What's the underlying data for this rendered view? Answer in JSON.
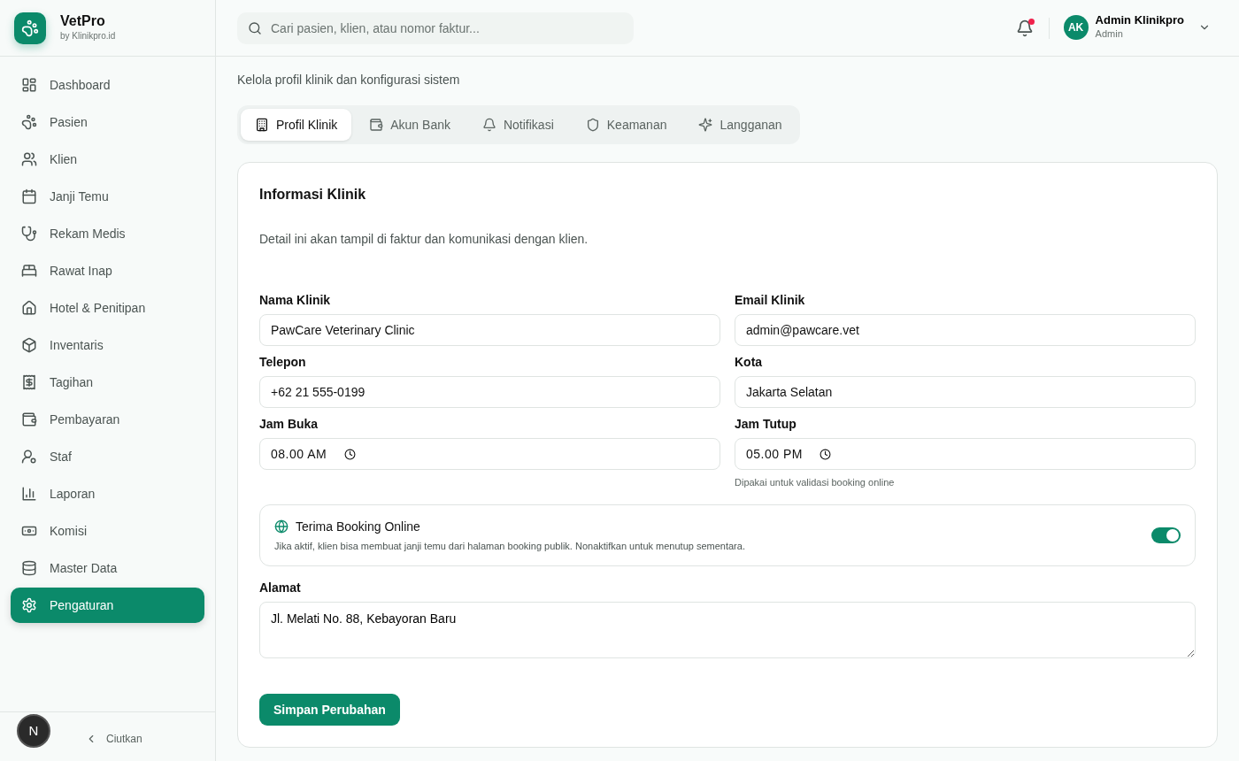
{
  "brand": {
    "name": "VetPro",
    "tagline": "by Klinikpro.id"
  },
  "sidebar": {
    "items": [
      {
        "label": "Dashboard",
        "selected": false
      },
      {
        "label": "Pasien",
        "selected": false
      },
      {
        "label": "Klien",
        "selected": false
      },
      {
        "label": "Janji Temu",
        "selected": false
      },
      {
        "label": "Rekam Medis",
        "selected": false
      },
      {
        "label": "Rawat Inap",
        "selected": false
      },
      {
        "label": "Hotel & Penitipan",
        "selected": false
      },
      {
        "label": "Inventaris",
        "selected": false
      },
      {
        "label": "Tagihan",
        "selected": false
      },
      {
        "label": "Pembayaran",
        "selected": false
      },
      {
        "label": "Staf",
        "selected": false
      },
      {
        "label": "Laporan",
        "selected": false
      },
      {
        "label": "Komisi",
        "selected": false
      },
      {
        "label": "Master Data",
        "selected": false
      },
      {
        "label": "Pengaturan",
        "selected": true
      }
    ],
    "collapse": "Ciutkan"
  },
  "dev_badge": "N",
  "search": {
    "placeholder": "Cari pasien, klien, atau nomor faktur..."
  },
  "notifications": {
    "unread": true
  },
  "user": {
    "initials": "AK",
    "name": "Admin Klinikpro",
    "role": "Admin"
  },
  "page": {
    "subtitle": "Kelola profil klinik dan konfigurasi sistem"
  },
  "tabs": [
    {
      "label": "Profil Klinik",
      "selected": true
    },
    {
      "label": "Akun Bank",
      "selected": false
    },
    {
      "label": "Notifikasi",
      "selected": false
    },
    {
      "label": "Keamanan",
      "selected": false
    },
    {
      "label": "Langganan",
      "selected": false
    }
  ],
  "card": {
    "title": "Informasi Klinik",
    "description": "Detail ini akan tampil di faktur dan komunikasi dengan klien.",
    "fields": [
      {
        "label": "Nama Klinik",
        "value": "PawCare Veterinary Clinic",
        "kind": "text"
      },
      {
        "label": "Email Klinik",
        "value": "admin@pawcare.vet",
        "kind": "text"
      },
      {
        "label": "Telepon",
        "value": "+62 21 555-0199",
        "kind": "text"
      },
      {
        "label": "Kota",
        "value": "Jakarta Selatan",
        "kind": "text"
      },
      {
        "label": "Jam Buka",
        "value": "08.00 AM",
        "kind": "time"
      },
      {
        "label": "Jam Tutup",
        "value": "05.00 PM",
        "kind": "time",
        "hint": "Dipakai untuk validasi booking online"
      }
    ],
    "booking": {
      "title": "Terima Booking Online",
      "description": "Jika aktif, klien bisa membuat janji temu dari halaman booking publik. Nonaktifkan untuk menutup sementara.",
      "on": true
    },
    "address": {
      "label": "Alamat",
      "value": "Jl. Melati No. 88, Kebayoran Baru"
    },
    "save": "Simpan Perubahan"
  }
}
